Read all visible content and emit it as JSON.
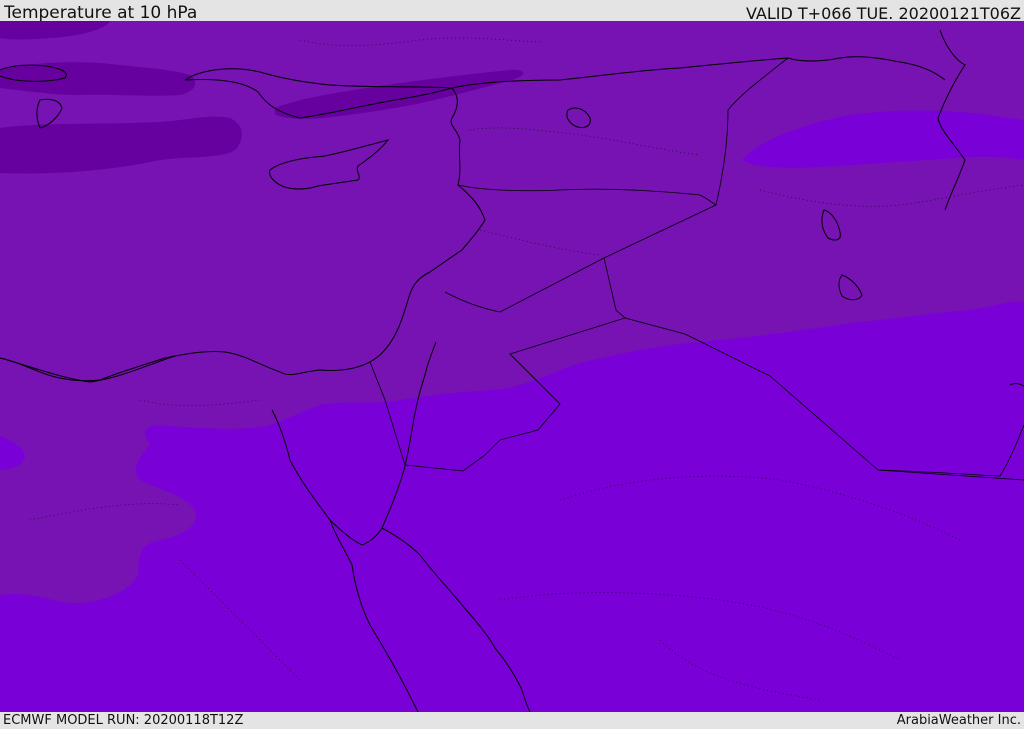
{
  "header": {
    "title": "Temperature at 10 hPa",
    "valid": "VALID T+066 TUE. 20200121T06Z"
  },
  "footer": {
    "model_run": "ECMWF MODEL RUN: 20200118T12Z",
    "credit": "ArabiaWeather Inc."
  },
  "map": {
    "colors": {
      "band_cold": "#66009f",
      "band_mid": "#7712b3",
      "band_warm": "#7a00d8",
      "coastline": "#000000",
      "background": "#e4e4e4"
    }
  }
}
